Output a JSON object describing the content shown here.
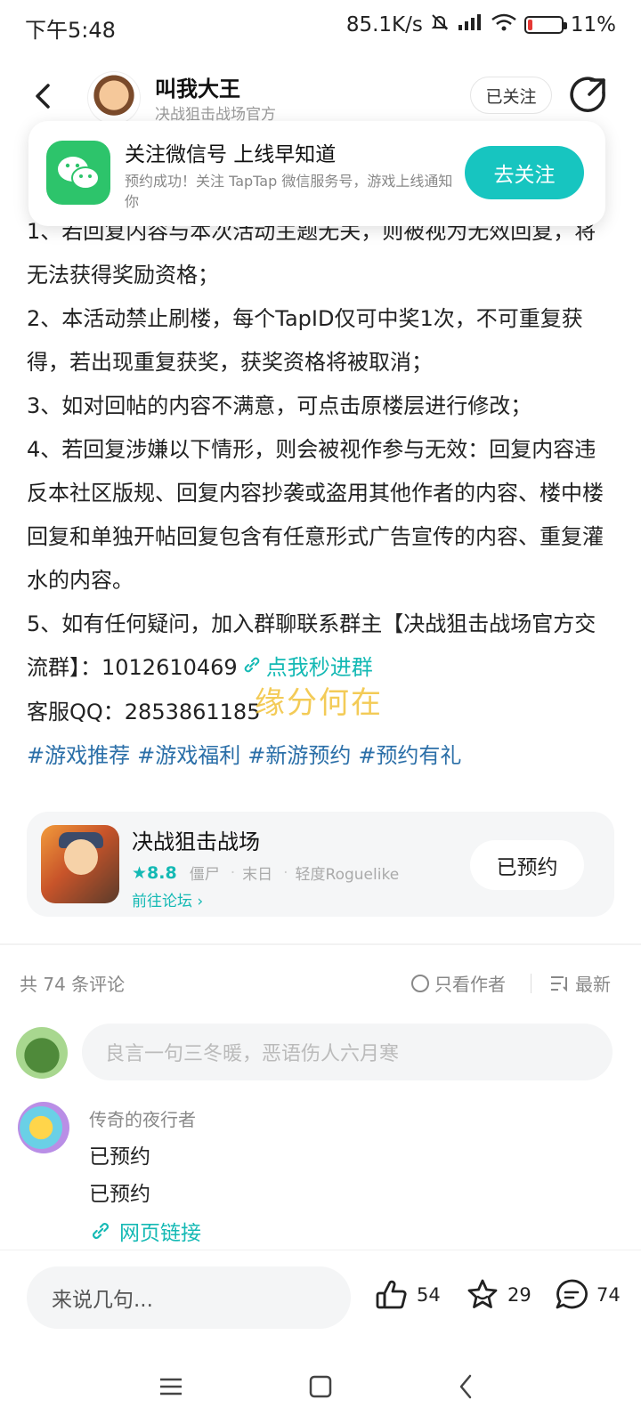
{
  "status_bar": {
    "time": "下午5:48",
    "net_speed": "85.1K/s",
    "battery_percent": "11%"
  },
  "header": {
    "author_name": "叫我大王",
    "author_sub": "决战狙击战场官方",
    "follow_label": "已关注"
  },
  "wechat_card": {
    "title": "关注微信号 上线早知道",
    "desc": "预约成功！关注 TapTap 微信服务号，游戏上线通知你",
    "button": "去关注"
  },
  "article": {
    "p1": "1、若回复内容与本次活动主题无关，则被视为无效回复，将无法获得奖励资格；",
    "p2": "2、本活动禁止刷楼，每个TapID仅可中奖1次，不可重复获得，若出现重复获奖，获奖资格将被取消；",
    "p3": "3、如对回帖的内容不满意，可点击原楼层进行修改；",
    "p4": "4、若回复涉嫌以下情形，则会被视作参与无效：回复内容违反本社区版规、回复内容抄袭或盗用其他作者的内容、楼中楼回复和单独开帖回复包含有任意形式广告宣传的内容、重复灌水的内容。",
    "p5_text": "5、如有任何疑问，加入群聊联系群主【决战狙击战场官方交流群】：1012610469",
    "p5_link": "点我秒进群",
    "kefu": "客服QQ：2853861185",
    "tags": [
      "#游戏推荐",
      "#游戏福利",
      "#新游预约",
      "#预约有礼"
    ]
  },
  "watermark": "缘分何在",
  "game_card": {
    "title": "决战狙击战场",
    "score": "8.8",
    "tags": [
      "僵尸",
      "末日",
      "轻度Roguelike"
    ],
    "forum_link": "前往论坛",
    "reserve_label": "已预约"
  },
  "comments": {
    "count_label": "共 74 条评论",
    "only_author": "只看作者",
    "sort": "最新",
    "input_placeholder": "良言一句三冬暖，恶语伤人六月寒",
    "items": [
      {
        "name": "传奇的夜行者",
        "line1": "已预约",
        "line2": "已预约",
        "link": "网页链接"
      }
    ]
  },
  "bottom_bar": {
    "say_placeholder": "来说几句...",
    "likes": "54",
    "favorites": "29",
    "comments": "74"
  },
  "colors": {
    "accent": "#14b9b4",
    "wechat_green": "#2dc46b",
    "tag_blue": "#2b6fa8",
    "watermark": "#f2c23a"
  }
}
